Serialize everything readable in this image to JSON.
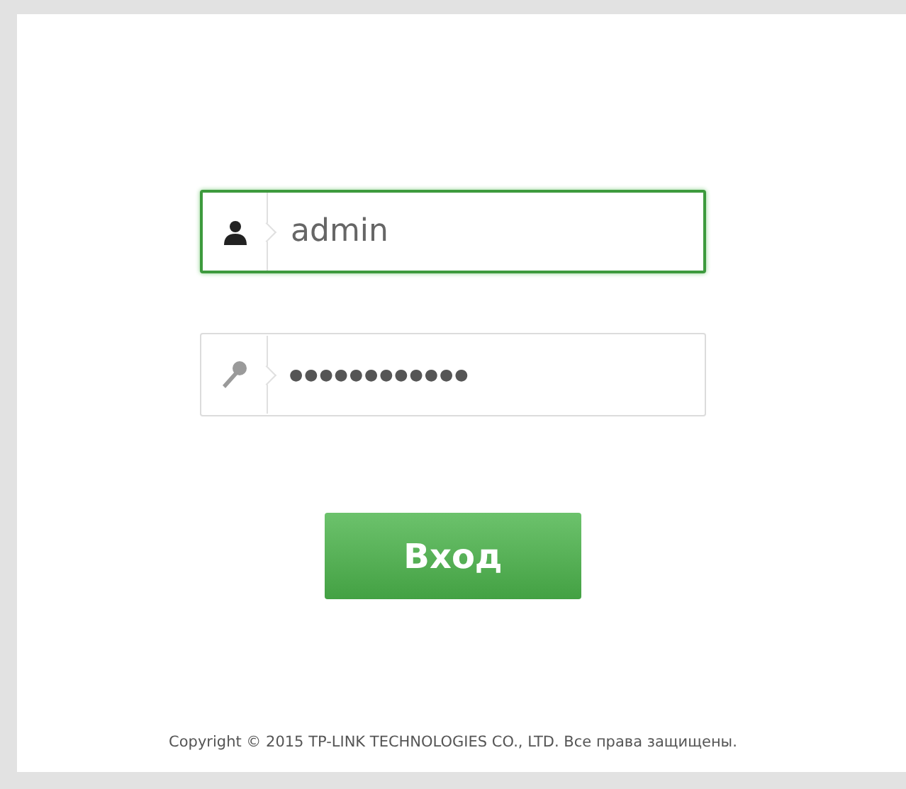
{
  "login_form": {
    "fields": [
      {
        "kind": "user",
        "value": "admin",
        "focused": true
      },
      {
        "kind": "password",
        "value": "●●●●●●●●●●●●",
        "focused": false
      }
    ],
    "submit_button": "Вход"
  },
  "footer": {
    "copyright": "Copyright © 2015 TP-LINK TECHNOLOGIES CO., LTD. Все права защищены."
  }
}
